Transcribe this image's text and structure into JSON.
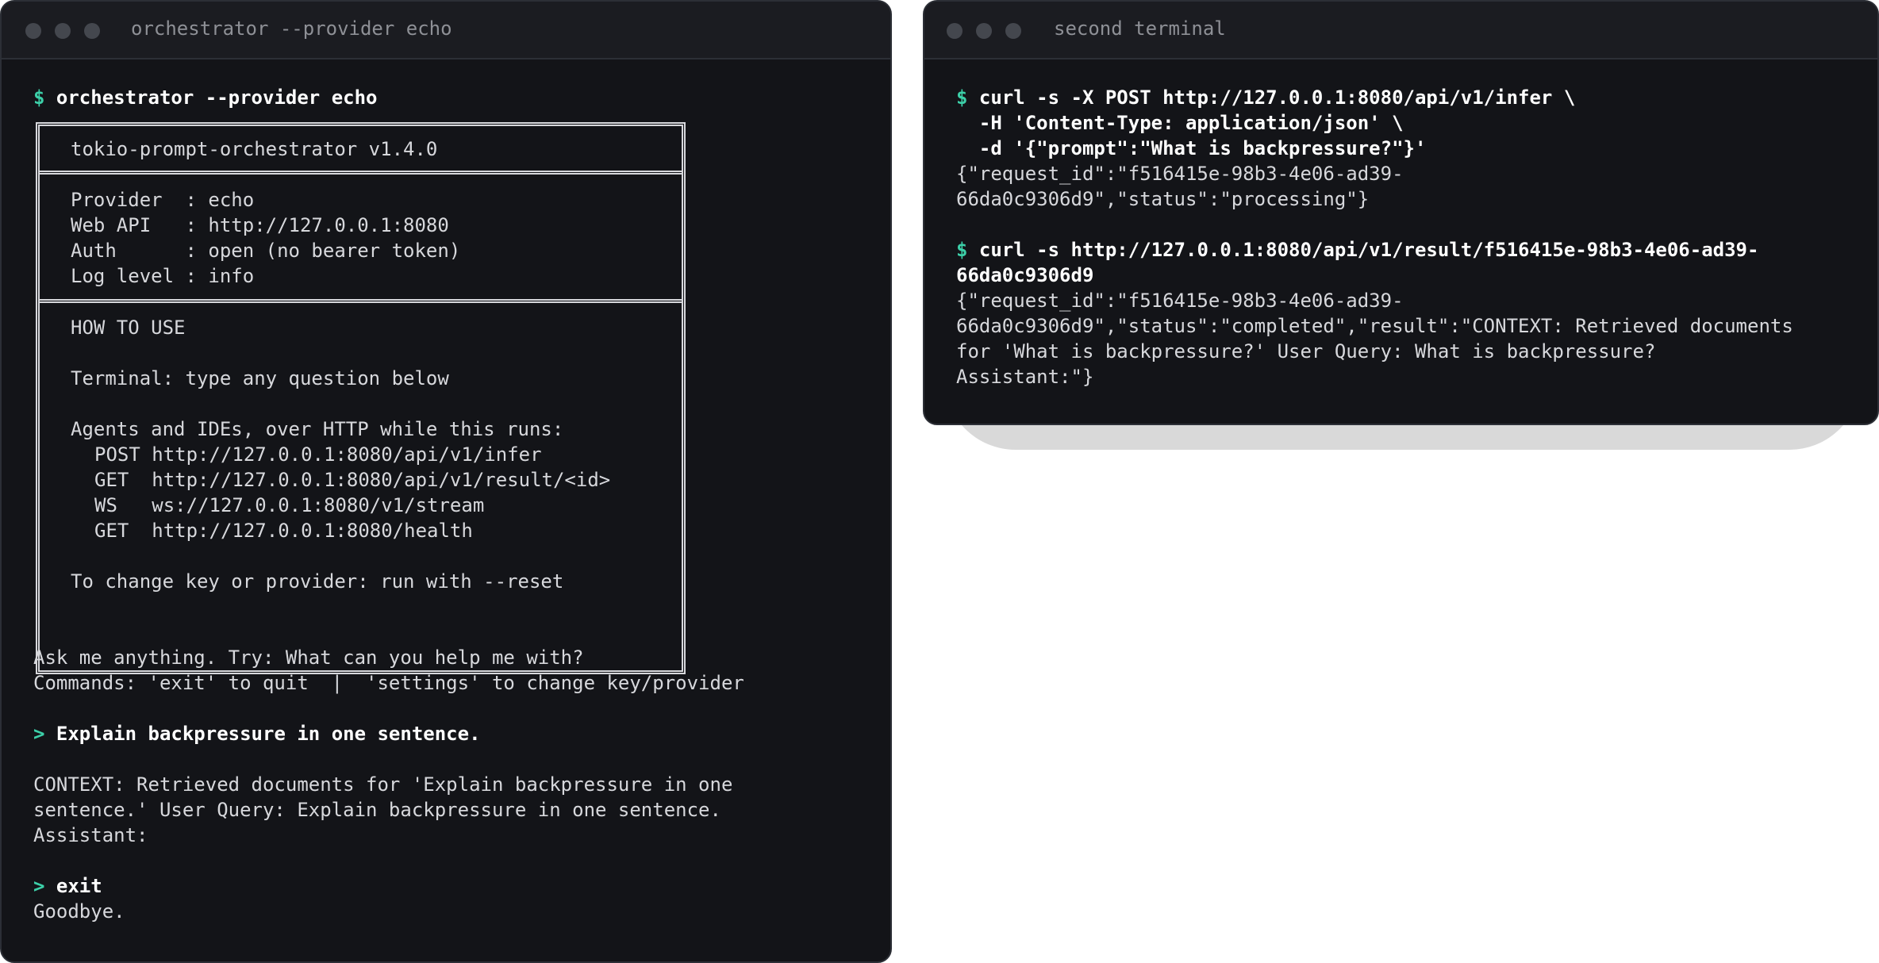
{
  "windows": {
    "left": {
      "title": "orchestrator --provider echo"
    },
    "right": {
      "title": "second terminal"
    }
  },
  "left_terminal": {
    "prompt_symbol": "$",
    "command": "orchestrator --provider echo",
    "banner": {
      "title": "tokio-prompt-orchestrator v1.4.0",
      "info": [
        "Provider  : echo",
        "Web API   : http://127.0.0.1:8080",
        "Auth      : open (no bearer token)",
        "Log level : info"
      ],
      "howto_heading": "HOW TO USE",
      "terminal_hint": "Terminal: type any question below",
      "agents_hint": "Agents and IDEs, over HTTP while this runs:",
      "endpoints": [
        {
          "method": "POST",
          "url": "http://127.0.0.1:8080/api/v1/infer"
        },
        {
          "method": "GET ",
          "url": "http://127.0.0.1:8080/api/v1/result/<id>"
        },
        {
          "method": "WS  ",
          "url": "ws://127.0.0.1:8080/v1/stream"
        },
        {
          "method": "GET ",
          "url": "http://127.0.0.1:8080/health"
        }
      ],
      "reset_hint": "To change key or provider: run with --reset"
    },
    "intro": [
      "Ask me anything. Try: What can you help me with?",
      "Commands: 'exit' to quit  |  'settings' to change key/provider"
    ],
    "input_symbol": ">",
    "query1": "Explain backpressure in one sentence.",
    "response1": [
      "CONTEXT: Retrieved documents for 'Explain backpressure in one",
      "sentence.' User Query: Explain backpressure in one sentence.",
      "Assistant:"
    ],
    "query2": "exit",
    "goodbye": "Goodbye."
  },
  "right_terminal": {
    "prompt_symbol": "$",
    "cmd1": [
      "curl -s -X POST http://127.0.0.1:8080/api/v1/infer \\",
      "  -H 'Content-Type: application/json' \\",
      "  -d '{\"prompt\":\"What is backpressure?\"}'"
    ],
    "out1": [
      "{\"request_id\":\"f516415e-98b3-4e06-ad39-",
      "66da0c9306d9\",\"status\":\"processing\"}"
    ],
    "cmd2": [
      "curl -s http://127.0.0.1:8080/api/v1/result/f516415e-98b3-4e06-ad39-",
      "66da0c9306d9"
    ],
    "out2": [
      "{\"request_id\":\"f516415e-98b3-4e06-ad39-",
      "66da0c9306d9\",\"status\":\"completed\",\"result\":\"CONTEXT: Retrieved documents",
      "for 'What is backpressure?' User Query: What is backpressure?",
      "Assistant:\"}"
    ]
  },
  "colors": {
    "background": "#131418",
    "titlebar": "#1b1c21",
    "prompt_accent": "#3ccfa8",
    "text": "#d7d8dc"
  }
}
